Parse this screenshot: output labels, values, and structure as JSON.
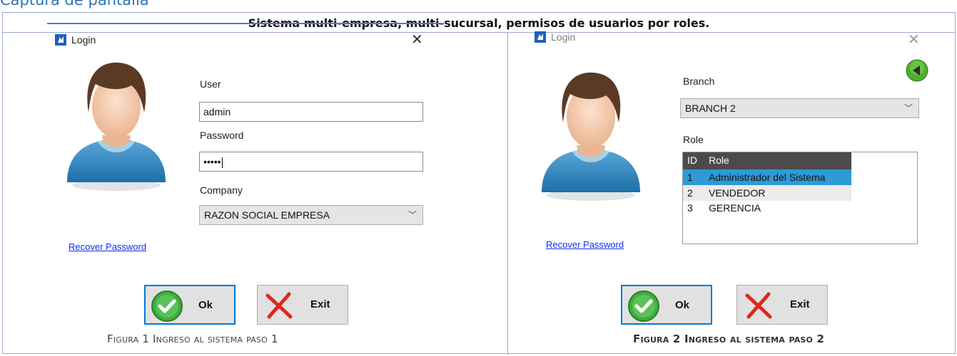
{
  "page": {
    "heading": "Captura de pantalla",
    "caption": "Sistema multi-empresa, multi-sucursal, permisos de usuarios por roles.",
    "figure1_caption": "Figura 1 Ingreso al sistema paso 1",
    "figure2_caption": "Figura 2 Ingreso al sistema paso 2"
  },
  "login1": {
    "title": "Login",
    "close": "✕",
    "user_label": "User",
    "user_value": "admin",
    "password_label": "Password",
    "password_value": "•••••",
    "company_label": "Company",
    "company_value": "RAZON SOCIAL EMPRESA",
    "recover": "Recover Password",
    "ok": "Ok",
    "exit": "Exit"
  },
  "login2": {
    "title": "Login",
    "close": "✕",
    "branch_label": "Branch",
    "branch_value": "BRANCH 2",
    "role_label": "Role",
    "roles_header": {
      "id": "ID",
      "role": "Role"
    },
    "roles": [
      {
        "id": "1",
        "name": "Administrador del Sistema"
      },
      {
        "id": "2",
        "name": "VENDEDOR"
      },
      {
        "id": "3",
        "name": "GERENCIA"
      }
    ],
    "recover": "Recover Password",
    "ok": "Ok",
    "exit": "Exit"
  },
  "colors": {
    "accent": "#0078d7",
    "heading": "#2e74b5",
    "selected_row": "#2e9bd6",
    "link": "#0b2ff3"
  },
  "icons": [
    "app-icon",
    "close-icon",
    "user-avatar",
    "check-icon",
    "x-icon",
    "back-arrow-icon",
    "chevron-down-icon"
  ]
}
